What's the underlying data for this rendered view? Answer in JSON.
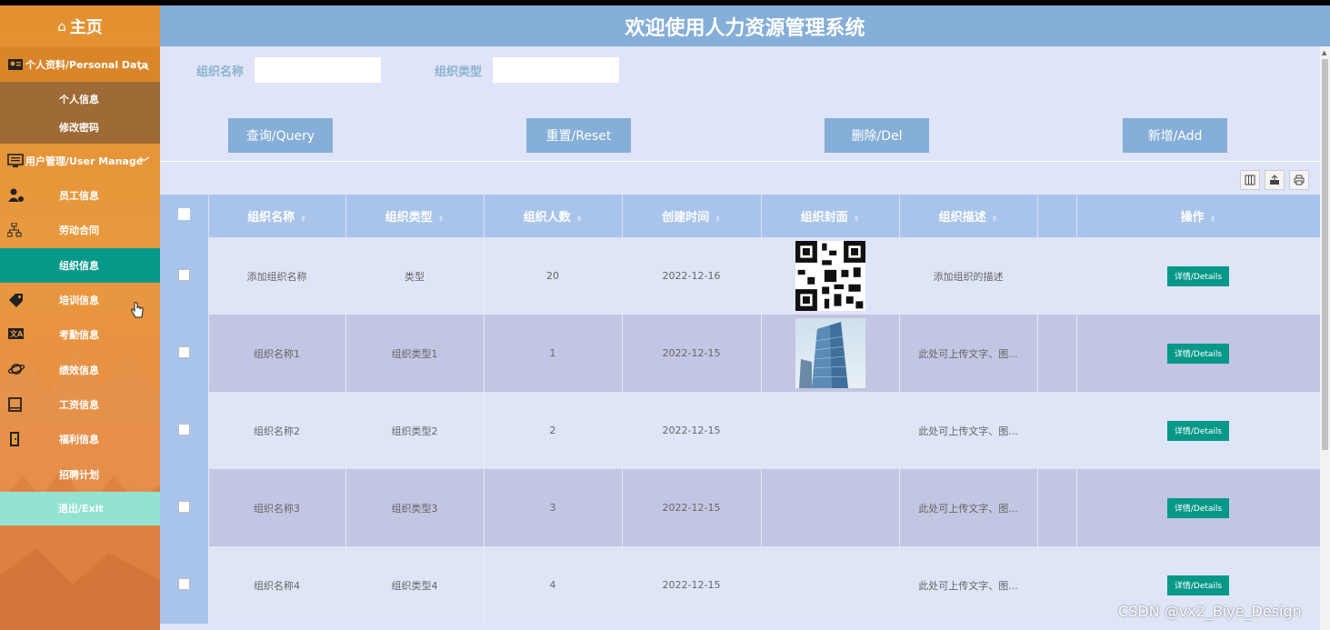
{
  "header": {
    "title": "欢迎使用人力资源管理系统"
  },
  "sidebar": {
    "home": "主页",
    "group_personal": {
      "label": "个人资料/Personal Data",
      "items": [
        "个人信息",
        "修改密码"
      ]
    },
    "group_user": {
      "label": "用户管理/User Manage"
    },
    "items": [
      {
        "label": "员工信息",
        "icon": "user-gear-icon"
      },
      {
        "label": "劳动合同",
        "icon": "org-chart-icon"
      },
      {
        "label": "组织信息",
        "icon": "",
        "active": true
      },
      {
        "label": "培训信息",
        "icon": "tag-icon"
      },
      {
        "label": "考勤信息",
        "icon": "translate-icon"
      },
      {
        "label": "绩效信息",
        "icon": "planet-icon"
      },
      {
        "label": "工资信息",
        "icon": "book-icon"
      },
      {
        "label": "福利信息",
        "icon": "door-icon"
      },
      {
        "label": "招聘计划",
        "icon": ""
      }
    ],
    "exit": "退出/Exit"
  },
  "search": {
    "name_label": "组织名称",
    "name_value": "",
    "type_label": "组织类型",
    "type_value": ""
  },
  "buttons": {
    "query": "查询/Query",
    "reset": "重置/Reset",
    "delete": "删除/Del",
    "add": "新增/Add"
  },
  "table": {
    "headers": [
      "组织名称",
      "组织类型",
      "组织人数",
      "创建时间",
      "组织封面",
      "组织描述",
      "",
      "操作"
    ],
    "detail_label": "详情/Details",
    "rows": [
      {
        "name": "添加组织名称",
        "type": "类型",
        "count": "20",
        "date": "2022-12-16",
        "desc": "添加组织的描述",
        "cover": "qr"
      },
      {
        "name": "组织名称1",
        "type": "组织类型1",
        "count": "1",
        "date": "2022-12-15",
        "desc": "此处可上传文字、图...",
        "cover": "building"
      },
      {
        "name": "组织名称2",
        "type": "组织类型2",
        "count": "2",
        "date": "2022-12-15",
        "desc": "此处可上传文字、图...",
        "cover": "blank"
      },
      {
        "name": "组织名称3",
        "type": "组织类型3",
        "count": "3",
        "date": "2022-12-15",
        "desc": "此处可上传文字、图...",
        "cover": "blank"
      },
      {
        "name": "组织名称4",
        "type": "组织类型4",
        "count": "4",
        "date": "2022-12-15",
        "desc": "此处可上传文字、图...",
        "cover": "blank"
      }
    ]
  },
  "watermark": "CSDN @vx2_Biye_Design",
  "colors": {
    "header": "#85aed8",
    "sidebar": "#e89a3f",
    "active": "#089888",
    "exit": "#93e3d2"
  }
}
